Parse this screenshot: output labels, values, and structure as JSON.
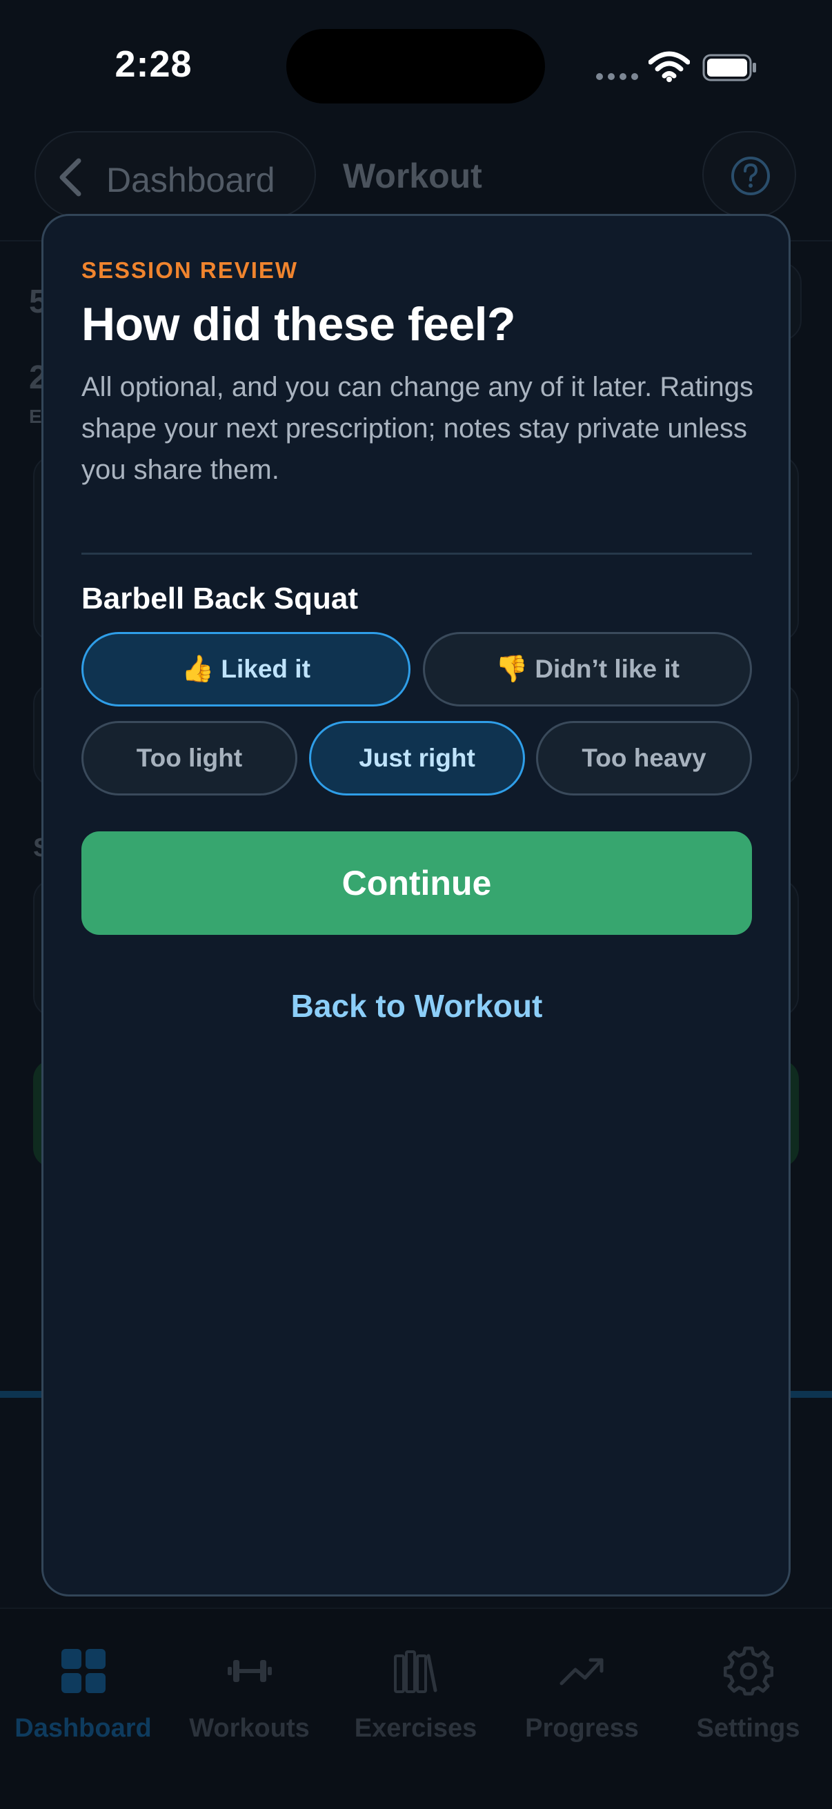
{
  "status_bar": {
    "time": "2:28"
  },
  "nav": {
    "back_label": "Dashboard",
    "title": "Workout"
  },
  "background_fragments": {
    "stat_a": "5",
    "stat_b": "2",
    "stat_b_caption": "E",
    "section_letter": "S"
  },
  "modal": {
    "eyebrow": "SESSION REVIEW",
    "title": "How did these feel?",
    "subtitle": "All optional, and you can change any of it later. Ratings shape your next prescription; notes stay private unless you share them.",
    "exercise": {
      "name": "Barbell Back Squat",
      "like_options": [
        {
          "emoji": "👍",
          "label": "Liked it",
          "selected": true
        },
        {
          "emoji": "👎",
          "label": "Didn’t like it",
          "selected": false
        }
      ],
      "load_options": [
        {
          "label": "Too light",
          "selected": false
        },
        {
          "label": "Just right",
          "selected": true
        },
        {
          "label": "Too heavy",
          "selected": false
        }
      ]
    },
    "continue_label": "Continue",
    "back_link_label": "Back to Workout"
  },
  "tab_bar": {
    "items": [
      {
        "label": "Dashboard",
        "icon": "grid-icon",
        "active": true
      },
      {
        "label": "Workouts",
        "icon": "dumbbell-icon",
        "active": false
      },
      {
        "label": "Exercises",
        "icon": "books-icon",
        "active": false
      },
      {
        "label": "Progress",
        "icon": "trend-icon",
        "active": false
      },
      {
        "label": "Settings",
        "icon": "gear-icon",
        "active": false
      }
    ]
  },
  "colors": {
    "accent_orange": "#f0842e",
    "selected_blue": "#2f9ee8",
    "continue_green": "#37a66f",
    "link_blue": "#8ccef8"
  }
}
